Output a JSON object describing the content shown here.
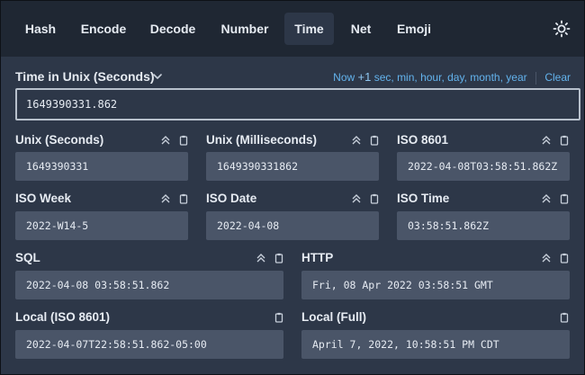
{
  "nav": {
    "tabs": [
      "Hash",
      "Encode",
      "Decode",
      "Number",
      "Time",
      "Net",
      "Emoji"
    ],
    "active_tab": "Time"
  },
  "header": {
    "title": "Time in Unix (Seconds)",
    "now": "Now",
    "plus": "+1",
    "units": [
      "sec",
      "min",
      "hour",
      "day",
      "month",
      "year"
    ],
    "clear": "Clear"
  },
  "input": {
    "value": "1649390331.862"
  },
  "fields": {
    "unix_seconds": {
      "label": "Unix (Seconds)",
      "value": "1649390331"
    },
    "unix_millis": {
      "label": "Unix (Milliseconds)",
      "value": "1649390331862"
    },
    "iso8601": {
      "label": "ISO 8601",
      "value": "2022-04-08T03:58:51.862Z"
    },
    "iso_week": {
      "label": "ISO Week",
      "value": "2022-W14-5"
    },
    "iso_date": {
      "label": "ISO Date",
      "value": "2022-04-08"
    },
    "iso_time": {
      "label": "ISO Time",
      "value": "03:58:51.862Z"
    },
    "sql": {
      "label": "SQL",
      "value": "2022-04-08 03:58:51.862"
    },
    "http": {
      "label": "HTTP",
      "value": "Fri, 08 Apr 2022 03:58:51 GMT"
    },
    "local_iso": {
      "label": "Local (ISO 8601)",
      "value": "2022-04-07T22:58:51.862-05:00"
    },
    "local_full": {
      "label": "Local (Full)",
      "value": "April 7, 2022, 10:58:51 PM CDT"
    }
  },
  "colors": {
    "background": "#2d3748",
    "nav": "#1f2733",
    "field": "#4a5568",
    "link": "#63b3ed"
  },
  "icons": [
    "sun-icon",
    "chevron-down-icon",
    "double-chevron-up-icon",
    "copy-icon"
  ]
}
